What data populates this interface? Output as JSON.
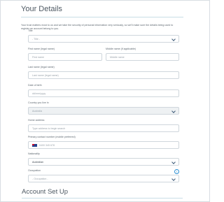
{
  "details": {
    "heading": "Your Details",
    "intro": "Your trust matters most to us and we take the security of personal information very seriously, so we'll make sure the details being used to register an account belong to you.",
    "title": {
      "label": "Title",
      "value": "- Title -"
    },
    "first_name": {
      "label": "First name (legal name)",
      "placeholder": "First name"
    },
    "middle_name": {
      "label": "Middle name (if applicable)",
      "placeholder": "Middle name"
    },
    "last_name": {
      "label": "Last name (legal name)",
      "placeholder": "Last name (legal name)"
    },
    "dob": {
      "label": "Date of birth",
      "placeholder": "dd/mm/yyyy"
    },
    "country": {
      "label": "Country you live in",
      "value": "Australia"
    },
    "home_address": {
      "label": "Home address",
      "placeholder": "Type address to begin search"
    },
    "phone": {
      "label": "Primary contact number (mobile preferred)",
      "placeholder": "0400 345 678"
    },
    "nationality": {
      "label": "Nationality",
      "value": "Australian"
    },
    "occupation": {
      "label": "Occupation",
      "value": "- Occupation -",
      "info_icon": "i"
    }
  },
  "account": {
    "heading": "Account Set Up"
  }
}
